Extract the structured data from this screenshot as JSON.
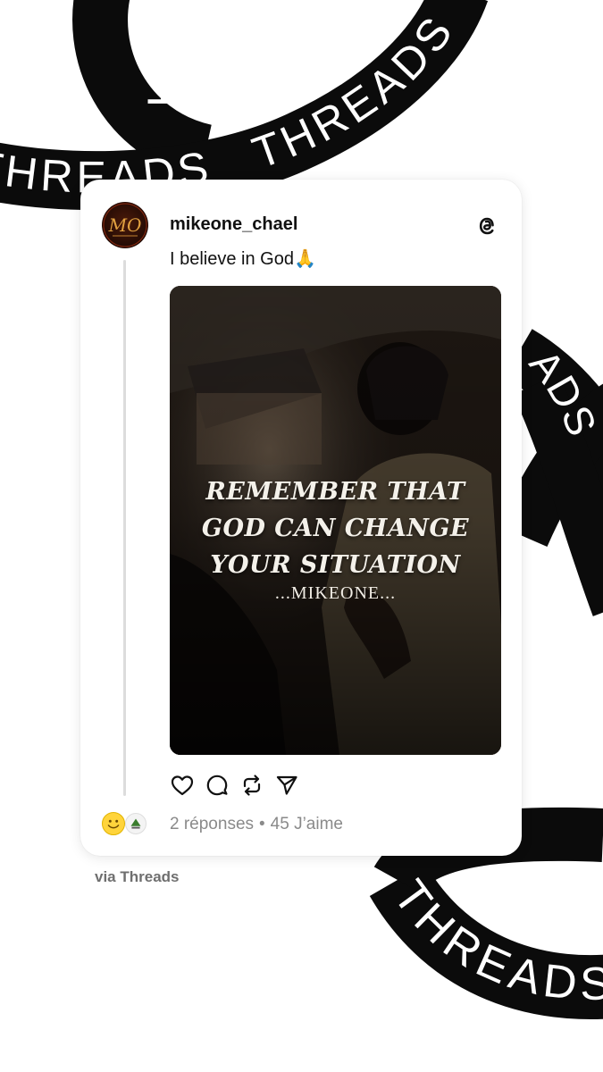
{
  "background": {
    "ribbon_text": "THREADS",
    "ribbon_color": "#0b0b0b",
    "ribbon_text_color": "#ffffff"
  },
  "post": {
    "username": "mikeone_chael",
    "avatar_initials": "MO",
    "text": "I believe in God🙏",
    "image": {
      "quote_lines": [
        "REMEMBER THAT",
        "GOD CAN CHANGE",
        "YOUR SITUATION"
      ],
      "signature": "...MIKEONE..."
    },
    "actions": [
      {
        "name": "like",
        "icon": "heart-icon"
      },
      {
        "name": "reply",
        "icon": "comment-icon"
      },
      {
        "name": "repost",
        "icon": "repost-icon"
      },
      {
        "name": "share",
        "icon": "send-icon"
      }
    ],
    "stats": {
      "replies": "2 réponses",
      "separator": "•",
      "likes": "45 J’aime"
    }
  },
  "footer": {
    "via": "via Threads"
  }
}
